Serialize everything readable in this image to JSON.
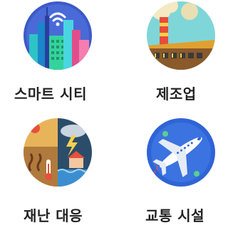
{
  "categories": [
    {
      "label": "스마트 시티",
      "icon": "smart-city-icon"
    },
    {
      "label": "제조업",
      "icon": "factory-icon"
    },
    {
      "label": "재난 대응",
      "icon": "disaster-response-icon"
    },
    {
      "label": "교통 시설",
      "icon": "airplane-icon"
    }
  ],
  "colors": {
    "label_text": "#222222",
    "city_bg": "#3d5ac8",
    "factory_bg": "#7fd6d8",
    "disaster_bg": "#2c4d6a",
    "transport_bg": "#2f64d6"
  }
}
